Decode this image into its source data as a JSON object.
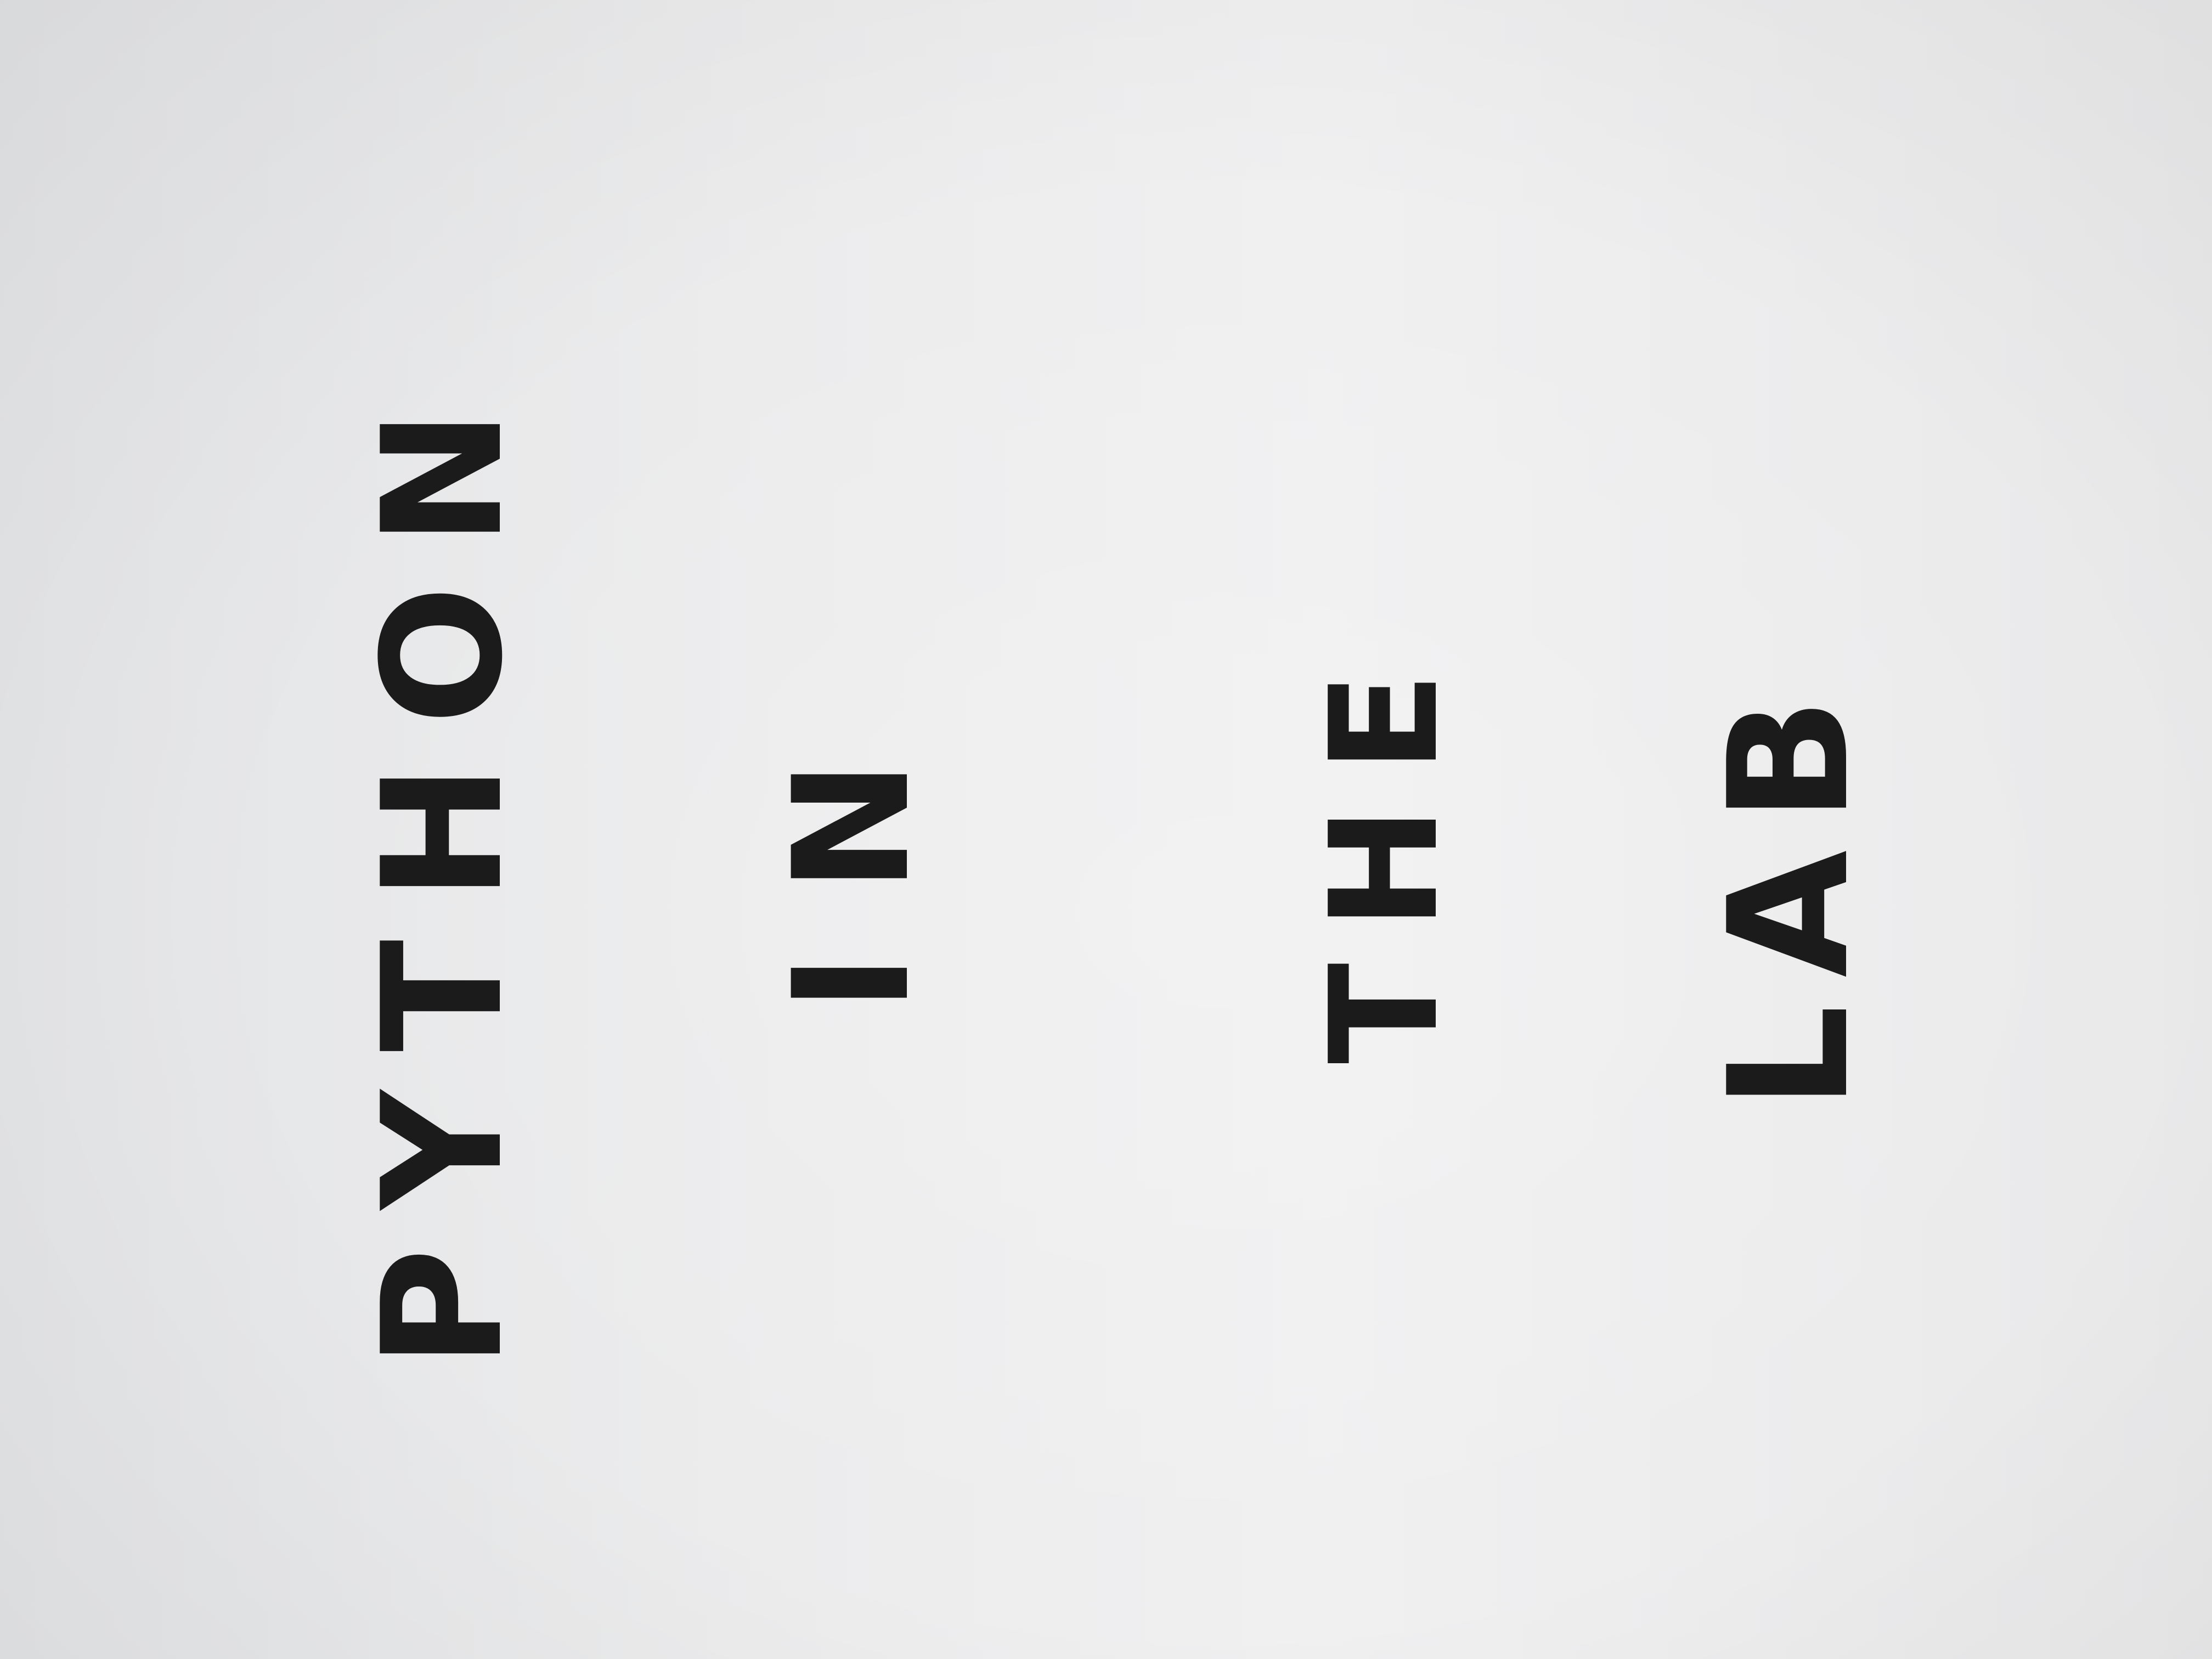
{
  "handwriting": {
    "lines": [
      "PYTHON",
      "IN",
      "THE",
      "LAB"
    ]
  },
  "colors": {
    "paper": "#ececed",
    "ink": "#1b1b1b"
  }
}
